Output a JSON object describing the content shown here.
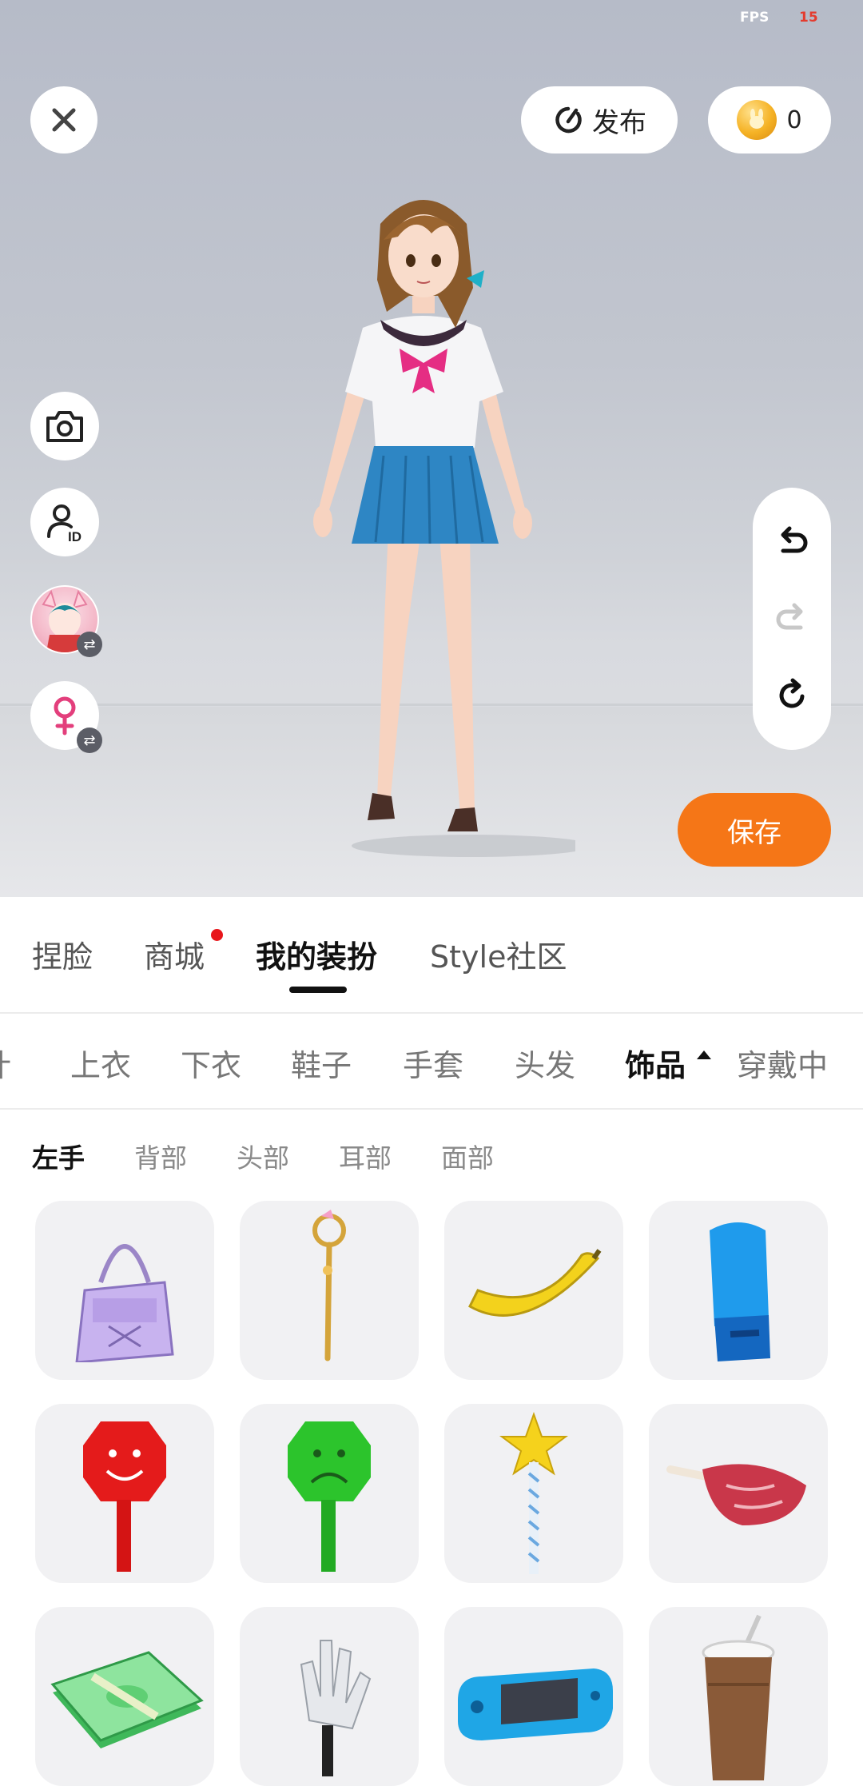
{
  "status": {
    "fps_label": "FPS",
    "fps_value": "15"
  },
  "top_bar": {
    "publish_label": "发布",
    "coin_count": "0"
  },
  "left_tools": [
    "camera-icon",
    "id-card-icon",
    "avatar-swap",
    "gender-swap"
  ],
  "history": [
    "undo-icon",
    "redo-icon",
    "reset-icon"
  ],
  "save_label": "保存",
  "main_tabs": [
    {
      "label": "捏脸",
      "active": false
    },
    {
      "label": "商城",
      "active": false,
      "notification_dot": true
    },
    {
      "label": "我的装扮",
      "active": true
    },
    {
      "label": "Style社区",
      "active": false
    }
  ],
  "category_tabs": [
    {
      "label": "计",
      "active": false
    },
    {
      "label": "上衣",
      "active": false
    },
    {
      "label": "下衣",
      "active": false
    },
    {
      "label": "鞋子",
      "active": false
    },
    {
      "label": "手套",
      "active": false
    },
    {
      "label": "头发",
      "active": false
    },
    {
      "label": "饰品",
      "active": true
    },
    {
      "label": "穿戴中",
      "active": false
    }
  ],
  "sub_tabs": [
    {
      "label": "左手",
      "active": true
    },
    {
      "label": "背部",
      "active": false
    },
    {
      "label": "头部",
      "active": false
    },
    {
      "label": "耳部",
      "active": false
    },
    {
      "label": "面部",
      "active": false
    }
  ],
  "items": [
    "purple-handbag",
    "golden-staff",
    "banana",
    "blue-boxing-glove",
    "red-smiley-sign",
    "green-sad-sign",
    "star-wand",
    "raw-steak",
    "cash-stack",
    "white-glove",
    "handheld-game-console",
    "coffee-cup"
  ],
  "colors": {
    "accent": "#f57617",
    "notification": "#e8161b",
    "fps_value": "#e43b2e"
  }
}
